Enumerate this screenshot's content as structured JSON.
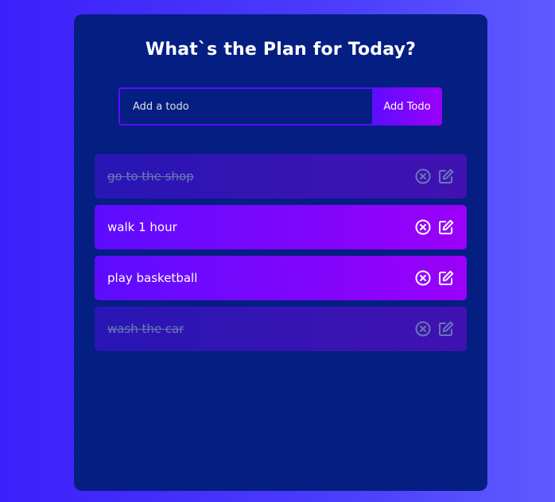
{
  "app": {
    "title": "What`s the Plan for Today?"
  },
  "form": {
    "input_placeholder": "Add a todo",
    "input_value": "",
    "add_button_label": "Add Todo"
  },
  "todos": [
    {
      "text": "go to the shop",
      "complete": true
    },
    {
      "text": "walk 1 hour",
      "complete": false
    },
    {
      "text": "play basketball",
      "complete": false
    },
    {
      "text": "wash the car",
      "complete": true
    }
  ],
  "icons": {
    "remove": "close-circle-icon",
    "edit": "edit-icon"
  },
  "colors": {
    "background_start": "#3d1ffb",
    "background_end": "#5d5bff",
    "panel": "#051e82",
    "accent_start": "#5d0cff",
    "accent_end": "#9b00fa",
    "text": "#ffffff"
  }
}
